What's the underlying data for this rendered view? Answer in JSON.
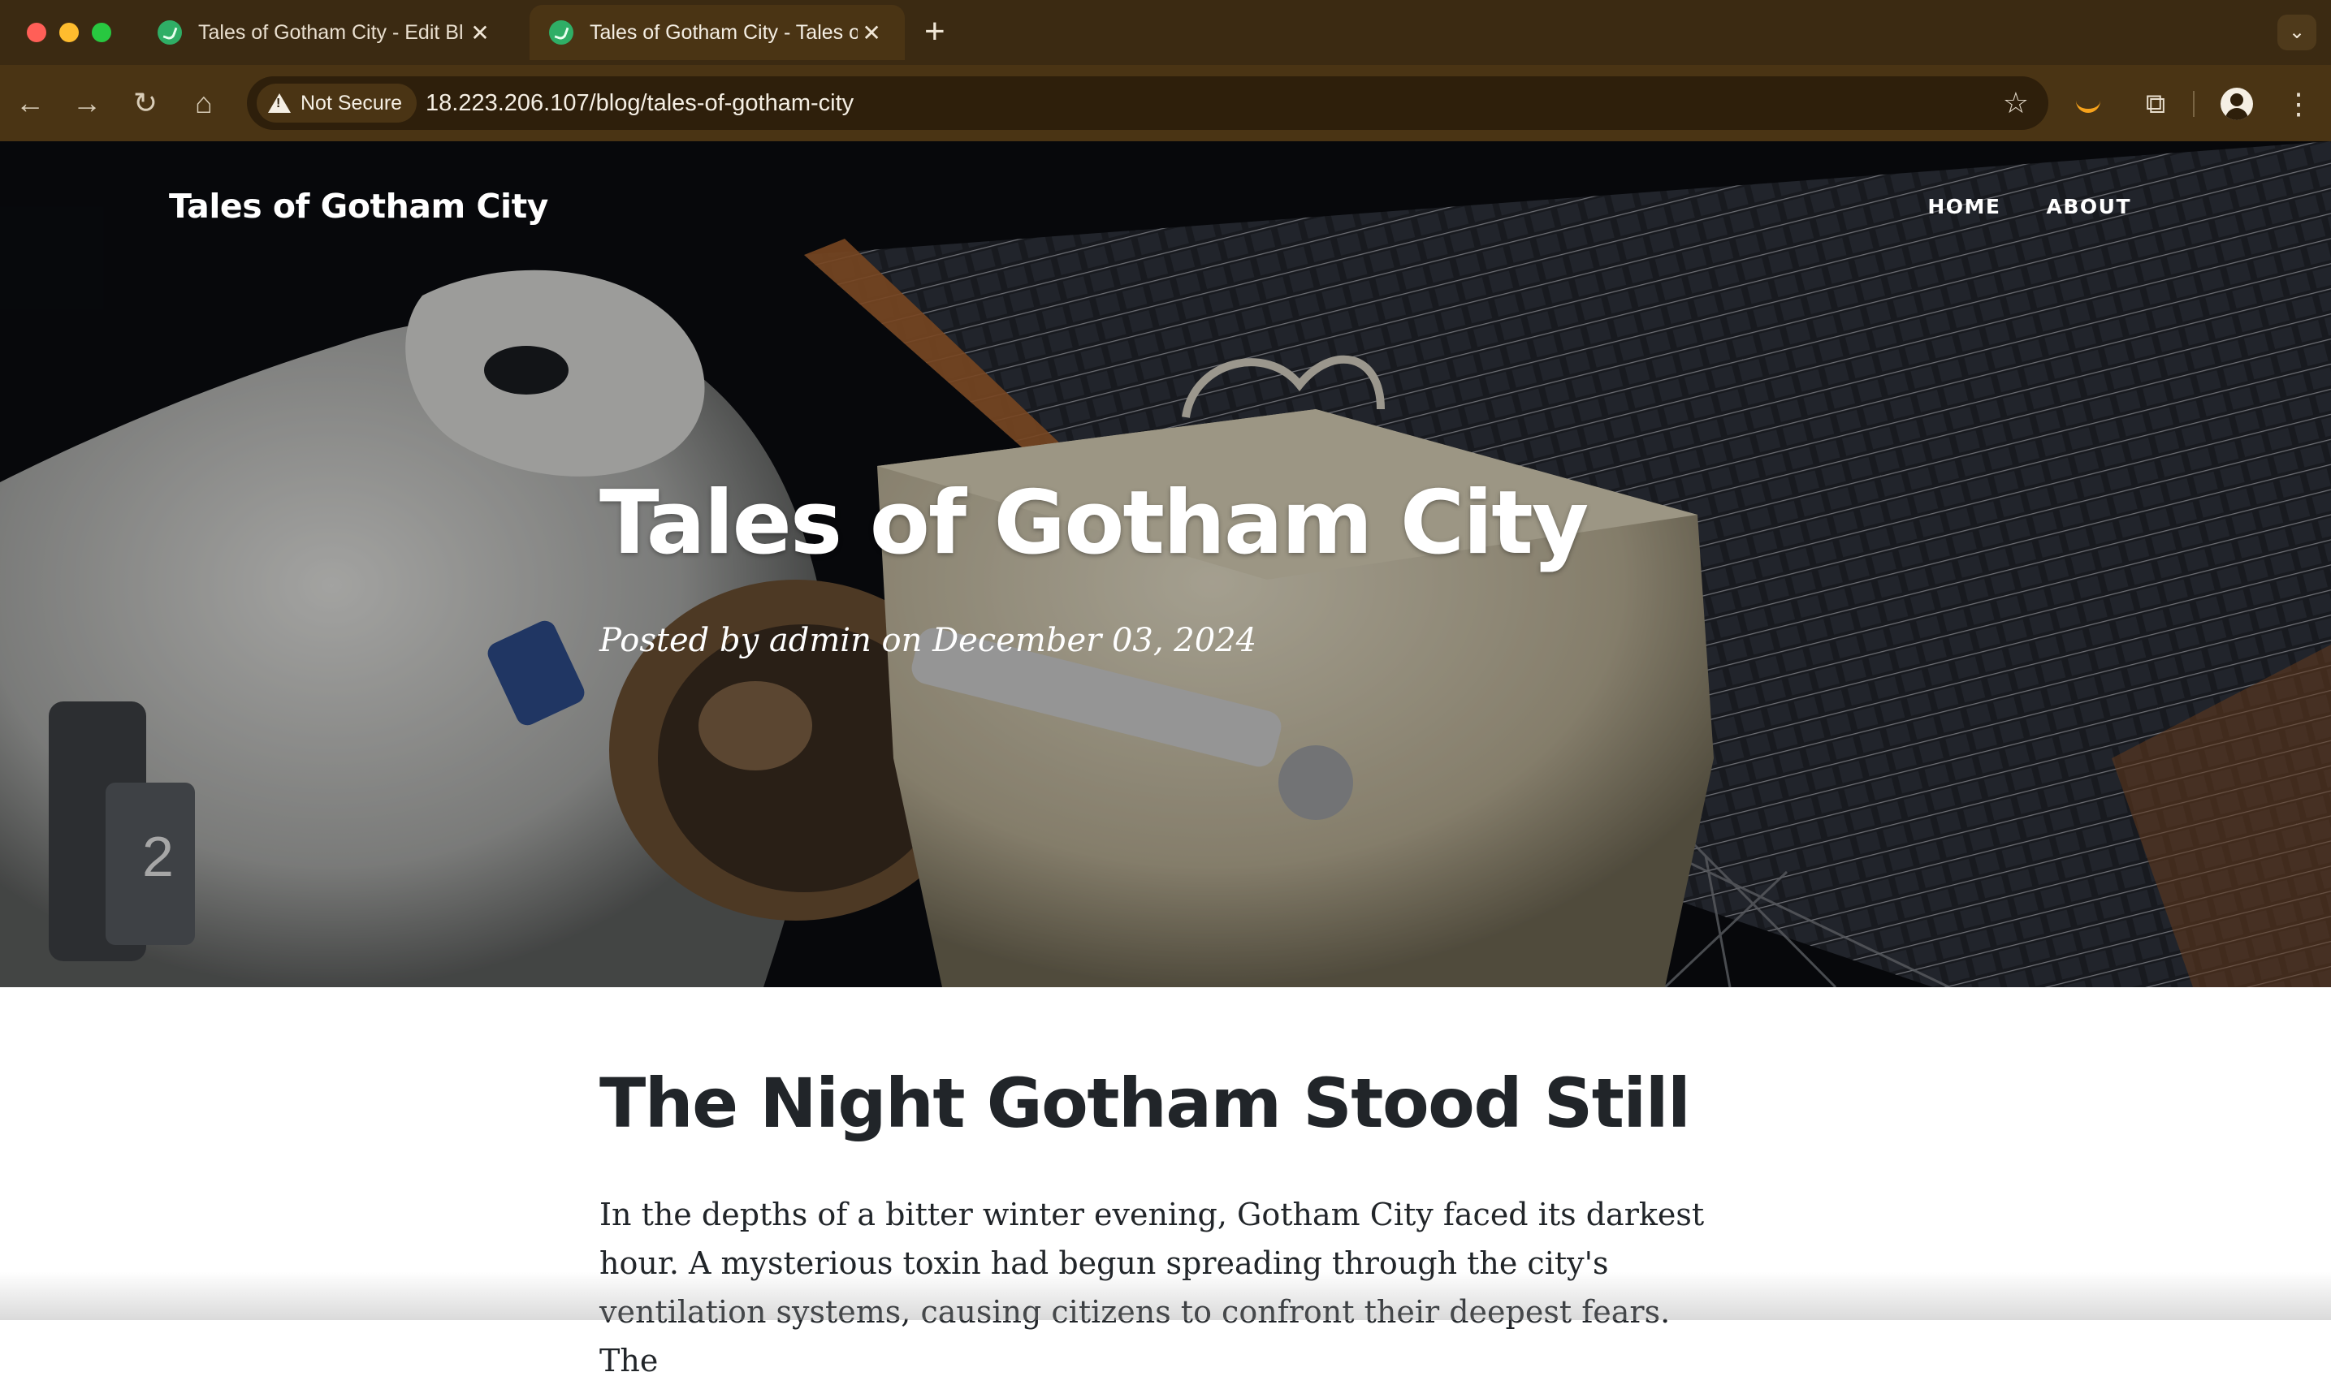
{
  "browser": {
    "tabs": [
      {
        "title": "Tales of Gotham City - Edit Bl",
        "active": false
      },
      {
        "title": "Tales of Gotham City - Tales o",
        "active": true
      }
    ],
    "new_tab_icon": "plus-icon",
    "tab_search_icon": "chevron-down-icon",
    "security_label": "Not Secure",
    "url": "18.223.206.107/blog/tales-of-gotham-city",
    "colors": {
      "tabbar": "#3b2a12",
      "toolbar": "#4a3414",
      "omnibox": "#2e1f0b"
    }
  },
  "site": {
    "brand": "Tales of Gotham City",
    "nav": [
      "HOME",
      "ABOUT"
    ]
  },
  "hero": {
    "title": "Tales of Gotham City",
    "meta": "Posted by admin on December 03, 2024",
    "image": "astronaut-spacewalk-solar-array"
  },
  "post": {
    "heading": "The Night Gotham Stood Still",
    "body": "In the depths of a bitter winter evening, Gotham City faced its darkest hour. A mysterious toxin had begun spreading through the city's ventilation systems, causing citizens to confront their deepest fears. The"
  }
}
